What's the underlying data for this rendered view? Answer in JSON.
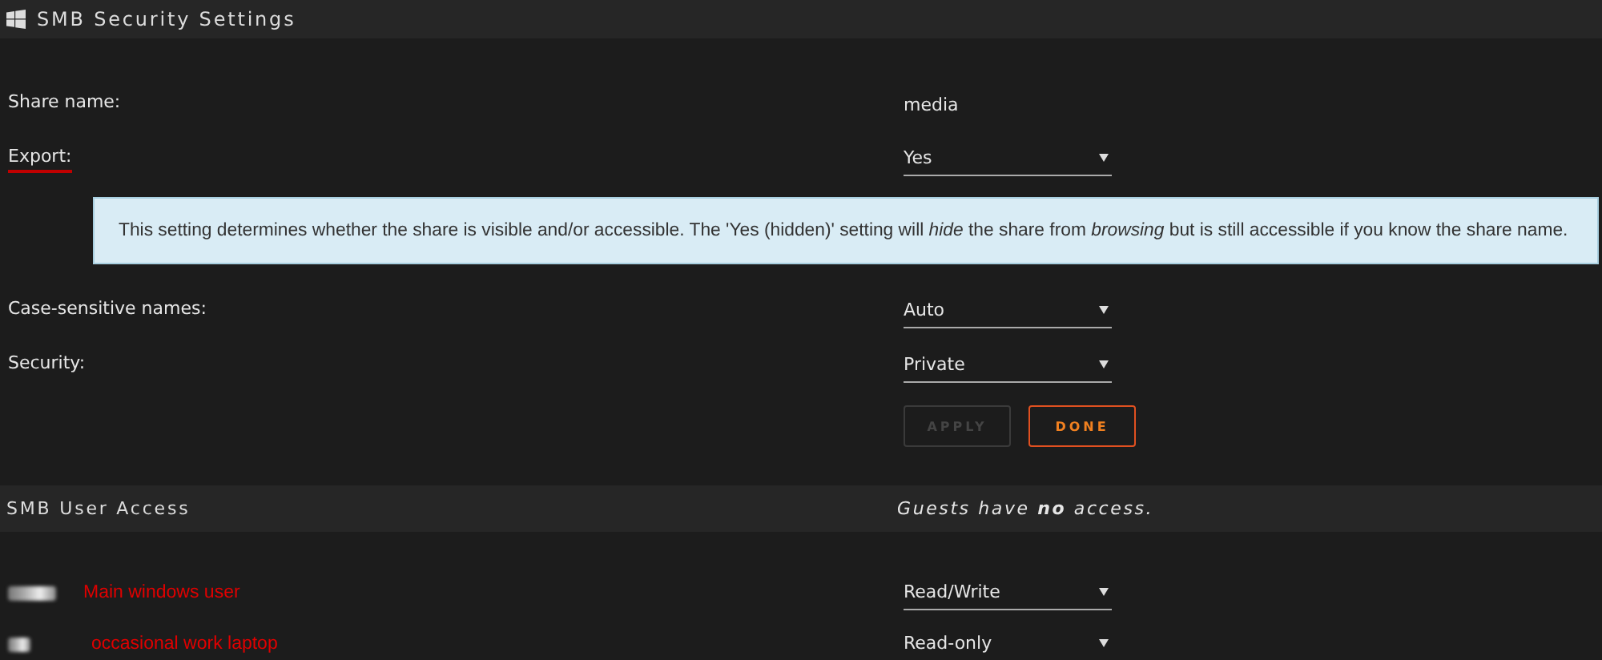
{
  "security_section": {
    "title": "SMB Security Settings"
  },
  "settings": [
    {
      "kind": "text",
      "label": "Share name:",
      "value": "media",
      "highlighted": false
    },
    {
      "kind": "select",
      "label": "Export:",
      "value": "Yes",
      "highlighted": true
    },
    {
      "kind": "help",
      "text": "This setting determines whether the share is visible and/or accessible. The 'Yes (hidden)' setting will *hide* the share from *browsing* but is still accessible if you know the share name."
    },
    {
      "kind": "select",
      "label": "Case-sensitive names:",
      "value": "Auto",
      "highlighted": false
    },
    {
      "kind": "select",
      "label": "Security:",
      "value": "Private",
      "highlighted": false
    }
  ],
  "buttons": [
    {
      "label": "APPLY",
      "disabled": true
    },
    {
      "label": "DONE",
      "disabled": false
    }
  ],
  "access_section": {
    "title": "SMB User Access",
    "note": "Guests have **no** access."
  },
  "users": [
    {
      "label": "Main windows user",
      "access": "Read/Write"
    },
    {
      "label": "occasional work laptop",
      "access": "Read-only"
    }
  ]
}
